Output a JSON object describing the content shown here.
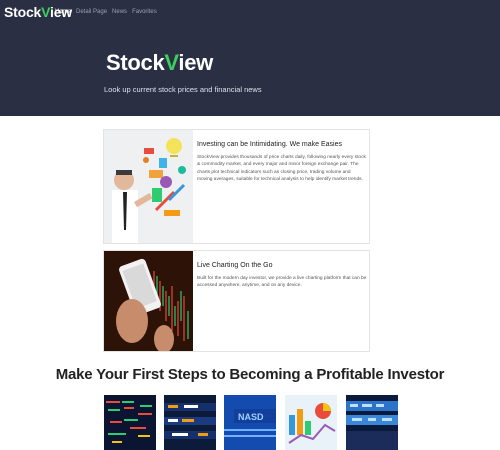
{
  "brand": {
    "name_prefix": "Stock",
    "name_v": "V",
    "name_suffix": "iew"
  },
  "nav": {
    "items": [
      {
        "label": "Home",
        "active": true
      },
      {
        "label": "Detail Page",
        "active": false
      },
      {
        "label": "News",
        "active": false
      },
      {
        "label": "Favorites",
        "active": false
      }
    ]
  },
  "hero": {
    "tagline": "Look up current stock prices and financial news"
  },
  "cards": [
    {
      "title": "Investing can be Intimidating. We make Easies",
      "text": "StockView provides thousands of price charts daily, following nearly every stock & commodity market, and every major and minor foreign exchange pair. The charts plot technical indicators such as closing price, trading volume and moving averages, suitable for technical analysis to help identify market trends."
    },
    {
      "title": "Live Charting On the Go",
      "text": "Built for the modern day investor, we provide a live charting platform that can be accessed anywhere, anytime, and on any device."
    }
  ],
  "steps": {
    "title": "Make Your First Steps to Becoming a Profitable Investor"
  },
  "colors": {
    "header_bg": "#2b2f43",
    "accent_green": "#3ccf5d",
    "text_dark": "#222222"
  }
}
